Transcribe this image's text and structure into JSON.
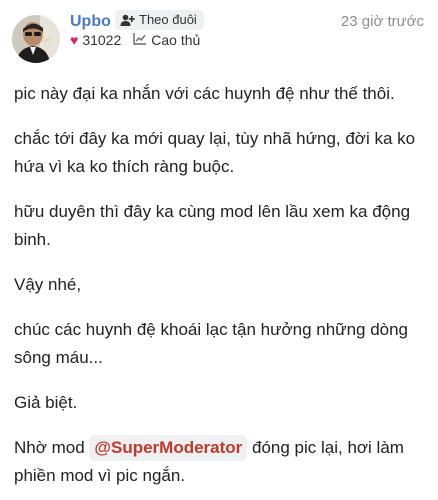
{
  "post": {
    "username": "Upbo",
    "follow_label": "Theo đuôi",
    "timestamp": "23 giờ trước",
    "likes": "31022",
    "rank": "Cao thủ",
    "colors": {
      "username": "#4a78c9",
      "heart": "#e0245e",
      "mention": "#c0392b"
    },
    "paragraphs": [
      "pic này đại ka nhắn với các huynh đệ như thế thôi.",
      "chắc tới đây ka mới quay lại, tùy nhã hứng, đời ka ko hứa vì ka ko thích ràng buộc.",
      "hữu duyên thì đây ka cùng mod lên lầu xem ka động binh.",
      "Vậy nhé,",
      "chúc các huynh đệ khoái lạc tận hưởng những dòng sông máu...",
      "Giả biệt."
    ],
    "last_paragraph": {
      "before": "Nhờ mod ",
      "mention": "@SuperModerator",
      "after": " đóng pic lại, hơi làm phiền mod vì pic ngắn."
    }
  }
}
